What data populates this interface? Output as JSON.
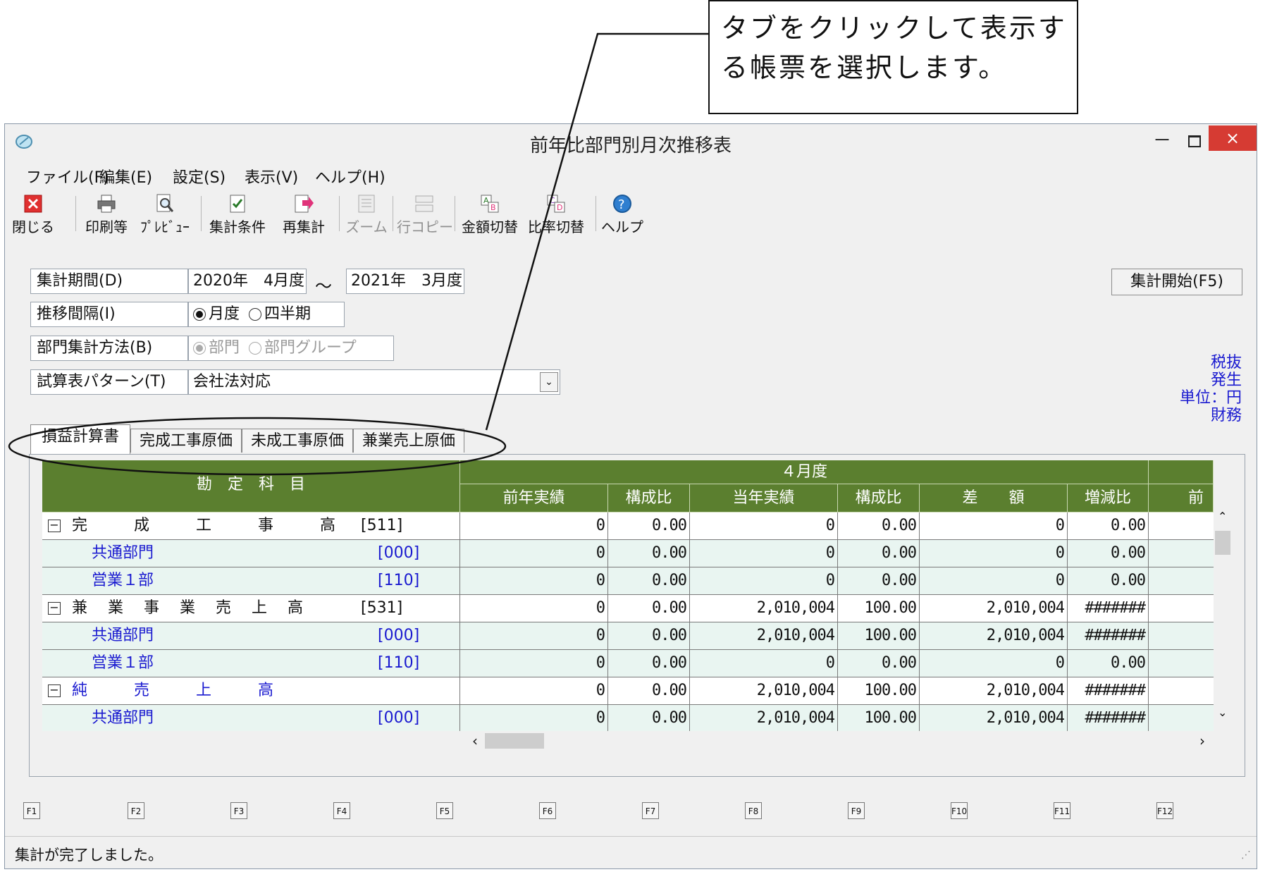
{
  "callout": {
    "line1": "タブをクリックして表示す",
    "line2": "る帳票を選択します。"
  },
  "window": {
    "title": "前年比部門別月次推移表"
  },
  "titlebar": {
    "minimize": "－",
    "close": "×"
  },
  "menu": [
    "ファイル(F)",
    "編集(E)",
    "設定(S)",
    "表示(V)",
    "ヘルプ(H)"
  ],
  "toolbar": {
    "close": "閉じる",
    "print": "印刷等",
    "preview": "ﾌﾟﾚﾋﾞｭｰ",
    "conditions": "集計条件",
    "recalc": "再集計",
    "zoom": "ズーム",
    "rowcopy": "行コピー",
    "amount_toggle": "金額切替",
    "ratio_toggle": "比率切替",
    "help": "ヘルプ"
  },
  "form": {
    "period_label": "集計期間(D)",
    "period_from": "2020年　4月度",
    "tilde": "～",
    "period_to": "2021年　3月度",
    "interval_label": "推移間隔(I)",
    "interval_month": "月度",
    "interval_quarter": "四半期",
    "dept_label": "部門集計方法(B)",
    "dept_dept": "部門",
    "dept_group": "部門グループ",
    "pattern_label": "試算表パターン(T)",
    "pattern_value": "会社法対応"
  },
  "run_button": "集計開始(F5)",
  "unit_info": {
    "tax": "税抜",
    "basis": "発生",
    "unit": "単位：円",
    "kind": "財務"
  },
  "tabs": [
    "損益計算書",
    "完成工事原価",
    "未成工事原価",
    "兼業売上原価"
  ],
  "grid": {
    "account_header": "勘　定　科　目",
    "month_header": "４月度",
    "columns": [
      "前年実績",
      "構成比",
      "当年実績",
      "構成比",
      "差　　額",
      "増減比",
      "前年"
    ],
    "rows": [
      {
        "type": "main",
        "name": "完　　　成　　　工　　　事　　　高",
        "code": "[511]",
        "blue": false,
        "prev": "0",
        "prev_ratio": "0.00",
        "curr": "0",
        "curr_ratio": "0.00",
        "diff": "0",
        "change": "0.00"
      },
      {
        "type": "sub",
        "name": "共通部門",
        "code": "[000]",
        "blue": true,
        "prev": "0",
        "prev_ratio": "0.00",
        "curr": "0",
        "curr_ratio": "0.00",
        "diff": "0",
        "change": "0.00"
      },
      {
        "type": "sub",
        "name": "営業１部",
        "code": "[110]",
        "blue": true,
        "prev": "0",
        "prev_ratio": "0.00",
        "curr": "0",
        "curr_ratio": "0.00",
        "diff": "0",
        "change": "0.00"
      },
      {
        "type": "main",
        "name": "兼　 業　 事　 業　 売　 上　 高",
        "code": "[531]",
        "blue": false,
        "prev": "0",
        "prev_ratio": "0.00",
        "curr": "2,010,004",
        "curr_ratio": "100.00",
        "diff": "2,010,004",
        "change": "#######"
      },
      {
        "type": "sub",
        "name": "共通部門",
        "code": "[000]",
        "blue": true,
        "prev": "0",
        "prev_ratio": "0.00",
        "curr": "2,010,004",
        "curr_ratio": "100.00",
        "diff": "2,010,004",
        "change": "#######"
      },
      {
        "type": "sub",
        "name": "営業１部",
        "code": "[110]",
        "blue": true,
        "prev": "0",
        "prev_ratio": "0.00",
        "curr": "0",
        "curr_ratio": "0.00",
        "diff": "0",
        "change": "0.00"
      },
      {
        "type": "main",
        "name": "純　　　売　　　上　　　高",
        "code": "",
        "blue": true,
        "prev": "0",
        "prev_ratio": "0.00",
        "curr": "2,010,004",
        "curr_ratio": "100.00",
        "diff": "2,010,004",
        "change": "#######"
      },
      {
        "type": "sub",
        "name": "共通部門",
        "code": "[000]",
        "blue": true,
        "prev": "0",
        "prev_ratio": "0.00",
        "curr": "2,010,004",
        "curr_ratio": "100.00",
        "diff": "2,010,004",
        "change": "#######"
      }
    ]
  },
  "function_keys": [
    "F1",
    "F2",
    "F3",
    "F4",
    "F5",
    "F6",
    "F7",
    "F8",
    "F9",
    "F10",
    "F11",
    "F12"
  ],
  "status": "集計が完了しました。",
  "colors": {
    "header_green": "#5b7f2f",
    "sub_row": "#e9f5f1",
    "blue_text": "#1a1ad0",
    "close_red": "#d63b33"
  }
}
